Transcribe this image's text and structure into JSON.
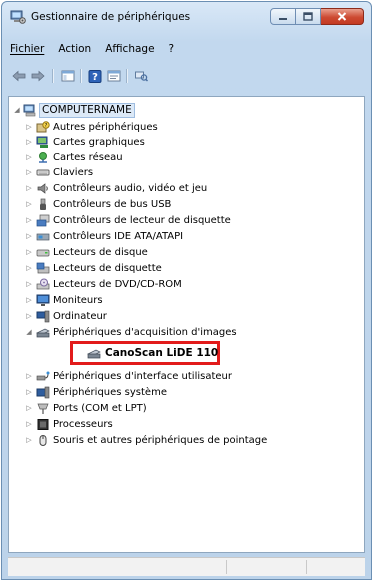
{
  "window": {
    "title": "Gestionnaire de périphériques",
    "colors": {
      "close_button": "#c8432c",
      "highlight_border": "#e21b1b",
      "selection": "#dce9f7"
    }
  },
  "menu": {
    "items": [
      "Fichier",
      "Action",
      "Affichage",
      "?"
    ]
  },
  "toolbar": {
    "buttons": [
      "back-arrow-icon",
      "forward-arrow-icon",
      "show-hide-tree-icon",
      "help-icon",
      "properties-icon",
      "scan-hardware-icon"
    ]
  },
  "tree": {
    "root": "COMPUTERNAME",
    "categories": [
      "Autres périphériques",
      "Cartes graphiques",
      "Cartes réseau",
      "Claviers",
      "Contrôleurs audio, vidéo et jeu",
      "Contrôleurs de bus USB",
      "Contrôleurs de lecteur de disquette",
      "Contrôleurs IDE ATA/ATAPI",
      "Lecteurs de disque",
      "Lecteurs de disquette",
      "Lecteurs de DVD/CD-ROM",
      "Moniteurs",
      "Ordinateur",
      "Périphériques d'acquisition d'images",
      "Périphériques d'interface utilisateur",
      "Périphériques système",
      "Ports (COM et LPT)",
      "Processeurs",
      "Souris et autres périphériques de pointage"
    ],
    "expanded_category": "Périphériques d'acquisition d'images",
    "highlighted_child": "CanoScan LiDE 110"
  }
}
